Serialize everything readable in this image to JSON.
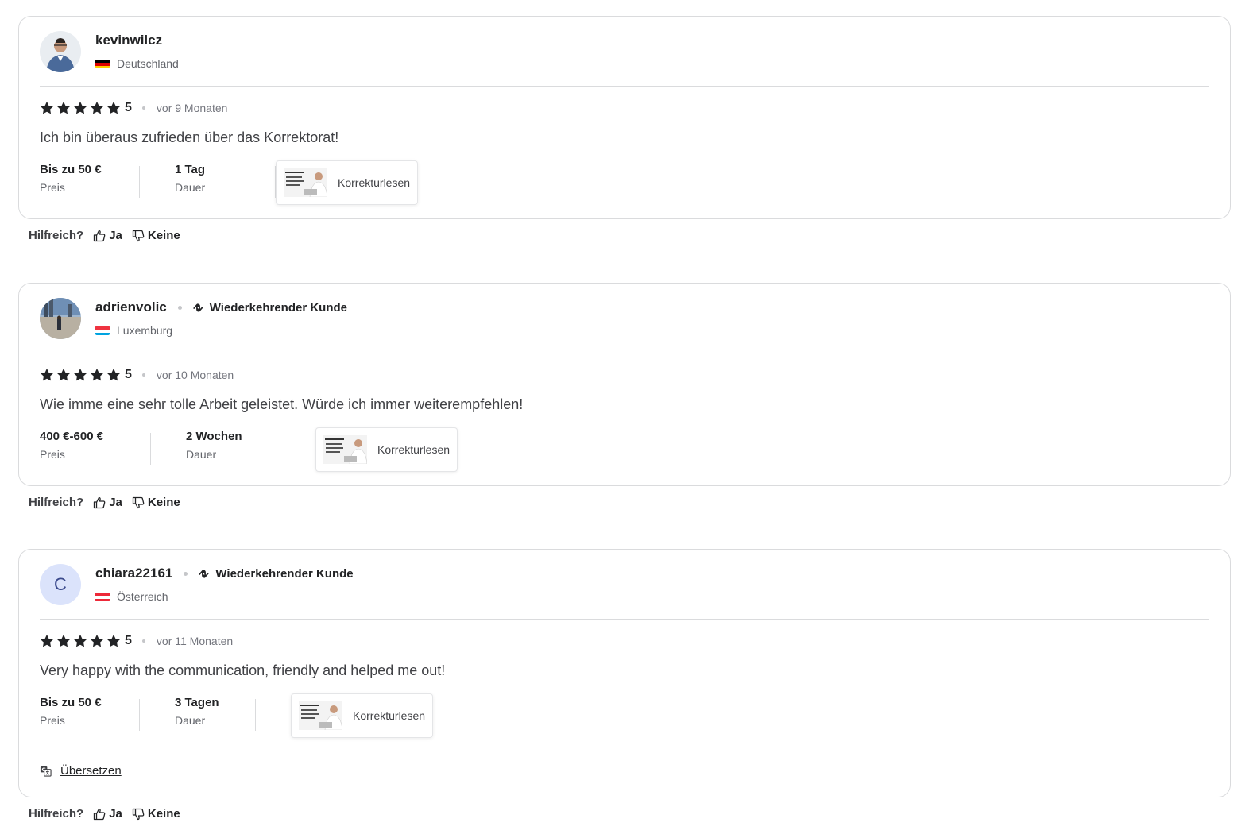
{
  "helpful": {
    "label": "Hilfreich?",
    "yes": "Ja",
    "no": "Keine"
  },
  "reviews": [
    {
      "username": "kevinwilcz",
      "country": "Deutschland",
      "repeat_badge": "",
      "rating": "5",
      "time": "vor 9 Monaten",
      "text": "Ich bin überaus zufrieden über das Korrektorat!",
      "price_value": "Bis zu 50 €",
      "price_label": "Preis",
      "duration_value": "1 Tag",
      "duration_label": "Dauer",
      "gig_label": "Korrekturlesen"
    },
    {
      "username": "adrienvolic",
      "country": "Luxemburg",
      "repeat_badge": "Wiederkehrender Kunde",
      "rating": "5",
      "time": "vor 10 Monaten",
      "text": "Wie imme eine sehr tolle Arbeit geleistet. Würde ich immer weiterempfehlen!",
      "price_value": "400 €-600 €",
      "price_label": "Preis",
      "duration_value": "2 Wochen",
      "duration_label": "Dauer",
      "gig_label": "Korrekturlesen"
    },
    {
      "username": "chiara22161",
      "avatar_letter": "C",
      "country": "Österreich",
      "repeat_badge": "Wiederkehrender Kunde",
      "rating": "5",
      "time": "vor 11 Monaten",
      "text": "Very happy with the communication, friendly and helped me out!",
      "price_value": "Bis zu 50 €",
      "price_label": "Preis",
      "duration_value": "3 Tagen",
      "duration_label": "Dauer",
      "gig_label": "Korrekturlesen",
      "translate_label": "Übersetzen"
    }
  ],
  "icons": {
    "star": "star-icon",
    "repeat": "repeat-icon",
    "thumbs_up": "thumbs-up-icon",
    "thumbs_down": "thumbs-down-icon",
    "translate": "translate-icon"
  },
  "colors": {
    "text": "#222325",
    "muted": "#62646a",
    "border": "#dadbdd"
  }
}
